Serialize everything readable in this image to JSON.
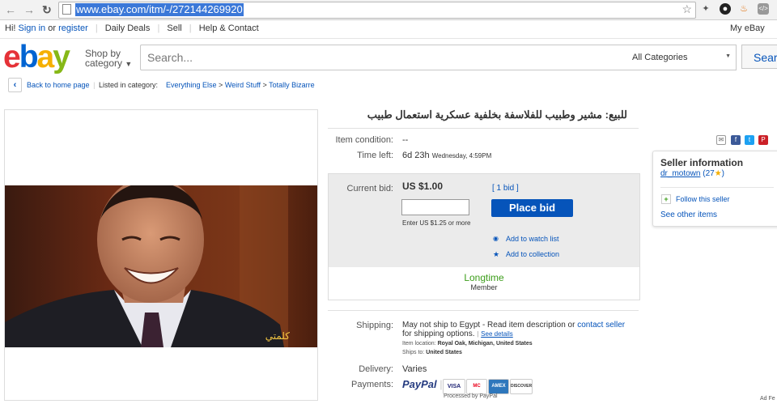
{
  "browser": {
    "url": "www.ebay.com/itm/-/272144269920"
  },
  "global_header": {
    "greeting": "Hi!",
    "sign_in": "Sign in",
    "or": "or",
    "register": "register",
    "daily_deals": "Daily Deals",
    "sell": "Sell",
    "help_contact": "Help & Contact",
    "my_ebay": "My eBay"
  },
  "logo_letters": [
    "e",
    "b",
    "a",
    "y"
  ],
  "colors": {
    "logo_e": "#e53238",
    "logo_b": "#0064d2",
    "logo_a": "#f5af02",
    "logo_y": "#86b817",
    "link": "#0654ba",
    "place_bid": "#0654ba",
    "longtime": "#3c9d1a"
  },
  "search": {
    "shop_by": "Shop by",
    "category": "category",
    "placeholder": "Search...",
    "all_categories": "All Categories",
    "button": "Searc"
  },
  "breadcrumb": {
    "back": "Back to home page",
    "listed_in": "Listed in category:",
    "cat1": "Everything Else",
    "cat2": "Weird Stuff",
    "cat3": "Totally Bizarre",
    "separator": ">"
  },
  "image": {
    "watermark": "كلمتي"
  },
  "item": {
    "title": "للبيع: مشير وطبيب للفلاسفة بخلفية عسكرية استعمال طبيب",
    "condition_label": "Item condition:",
    "condition_value": "--",
    "time_left_label": "Time left:",
    "time_left_value": "6d 23h",
    "time_left_detail": "Wednesday, 4:59PM",
    "current_bid_label": "Current bid:",
    "current_bid_value": "US $1.00",
    "bids": "[ 1 bid ]",
    "place_bid": "Place bid",
    "enter_hint": "Enter US $1.25 or more",
    "watch": "Add to watch list",
    "collection": "Add to collection",
    "longtime": "Longtime",
    "member": "Member",
    "shipping_label": "Shipping:",
    "shipping_text1": "May not ship to Egypt - Read item description or",
    "contact_seller": "contact seller",
    "shipping_text2": "for shipping options.",
    "see_details": "See details",
    "item_location_label": "Item location:",
    "item_location": "Royal Oak, Michigan, United States",
    "ships_to_label": "Ships to:",
    "ships_to": "United States",
    "delivery_label": "Delivery:",
    "delivery_value": "Varies",
    "payments_label": "Payments:",
    "paypal": "PayPal",
    "cards": [
      "VISA",
      "MC",
      "AMEX",
      "DISCOVER"
    ],
    "processed_by": "Processed by PayPal"
  },
  "seller": {
    "heading": "Seller information",
    "name": "dr_motown",
    "feedback": "(27",
    "feedback_close": ")",
    "follow": "Follow this seller",
    "see_other": "See other items"
  },
  "footer": {
    "ad_fragment": "Ad Fe"
  },
  "icons": {
    "back": "arrow-left-icon",
    "forward": "arrow-right-icon",
    "reload": "reload-icon",
    "star": "bookmark-star-icon",
    "watch": "eye-icon",
    "collection": "star-icon",
    "follow": "plus-icon"
  }
}
